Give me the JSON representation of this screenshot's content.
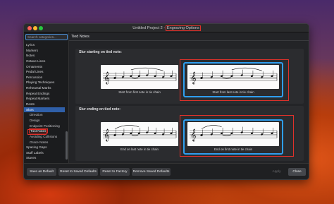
{
  "window": {
    "title_prefix": "Untitled Project 2 - ",
    "title_highlight": "Engraving Options"
  },
  "sidebar": {
    "search_placeholder": "Search categories...",
    "items": [
      {
        "label": "Lyrics",
        "level": 0
      },
      {
        "label": "Markers",
        "level": 0
      },
      {
        "label": "Notes",
        "level": 0
      },
      {
        "label": "Octave Lines",
        "level": 0
      },
      {
        "label": "Ornaments",
        "level": 0
      },
      {
        "label": "Pedal Lines",
        "level": 0
      },
      {
        "label": "Percussion",
        "level": 0
      },
      {
        "label": "Playing Techniques",
        "level": 0
      },
      {
        "label": "Rehearsal Marks",
        "level": 0
      },
      {
        "label": "Repeat Endings",
        "level": 0
      },
      {
        "label": "Repeat Markers",
        "level": 0
      },
      {
        "label": "Rests",
        "level": 0
      },
      {
        "label": "Slurs",
        "level": 0,
        "selected": true
      },
      {
        "label": "Direction",
        "level": 1
      },
      {
        "label": "Design",
        "level": 1
      },
      {
        "label": "Endpoint Positioning",
        "level": 1
      },
      {
        "label": "Tied Notes",
        "level": 1,
        "active": true
      },
      {
        "label": "Avoiding Collisions",
        "level": 1
      },
      {
        "label": "Grace Notes",
        "level": 1
      },
      {
        "label": "Spacing Gaps",
        "level": 0
      },
      {
        "label": "Staff Labels",
        "level": 0
      },
      {
        "label": "Staves",
        "level": 0
      }
    ]
  },
  "content": {
    "section_title": "Tied Notes",
    "group1": {
      "label": "Slur starting on tied note:",
      "options": [
        {
          "caption": "Start from first note in tie chain",
          "selected": false
        },
        {
          "caption": "Start from last note in tie chain",
          "selected": true
        }
      ]
    },
    "group2": {
      "label": "Slur ending on tied note:",
      "options": [
        {
          "caption": "End on last note in tie chain",
          "selected": false
        },
        {
          "caption": "End on first note in tie chain",
          "selected": true
        }
      ]
    }
  },
  "footer": {
    "save_default": "Save as Default",
    "reset_saved": "Reset to Saved Defaults",
    "reset_factory": "Reset to Factory",
    "remove_saved": "Remove Saved Defaults",
    "apply": "Apply",
    "close": "Close"
  },
  "colors": {
    "accent_blue": "#2f9ff0",
    "annotation_red": "#e0312b",
    "selected_row": "#2f5fa8"
  }
}
